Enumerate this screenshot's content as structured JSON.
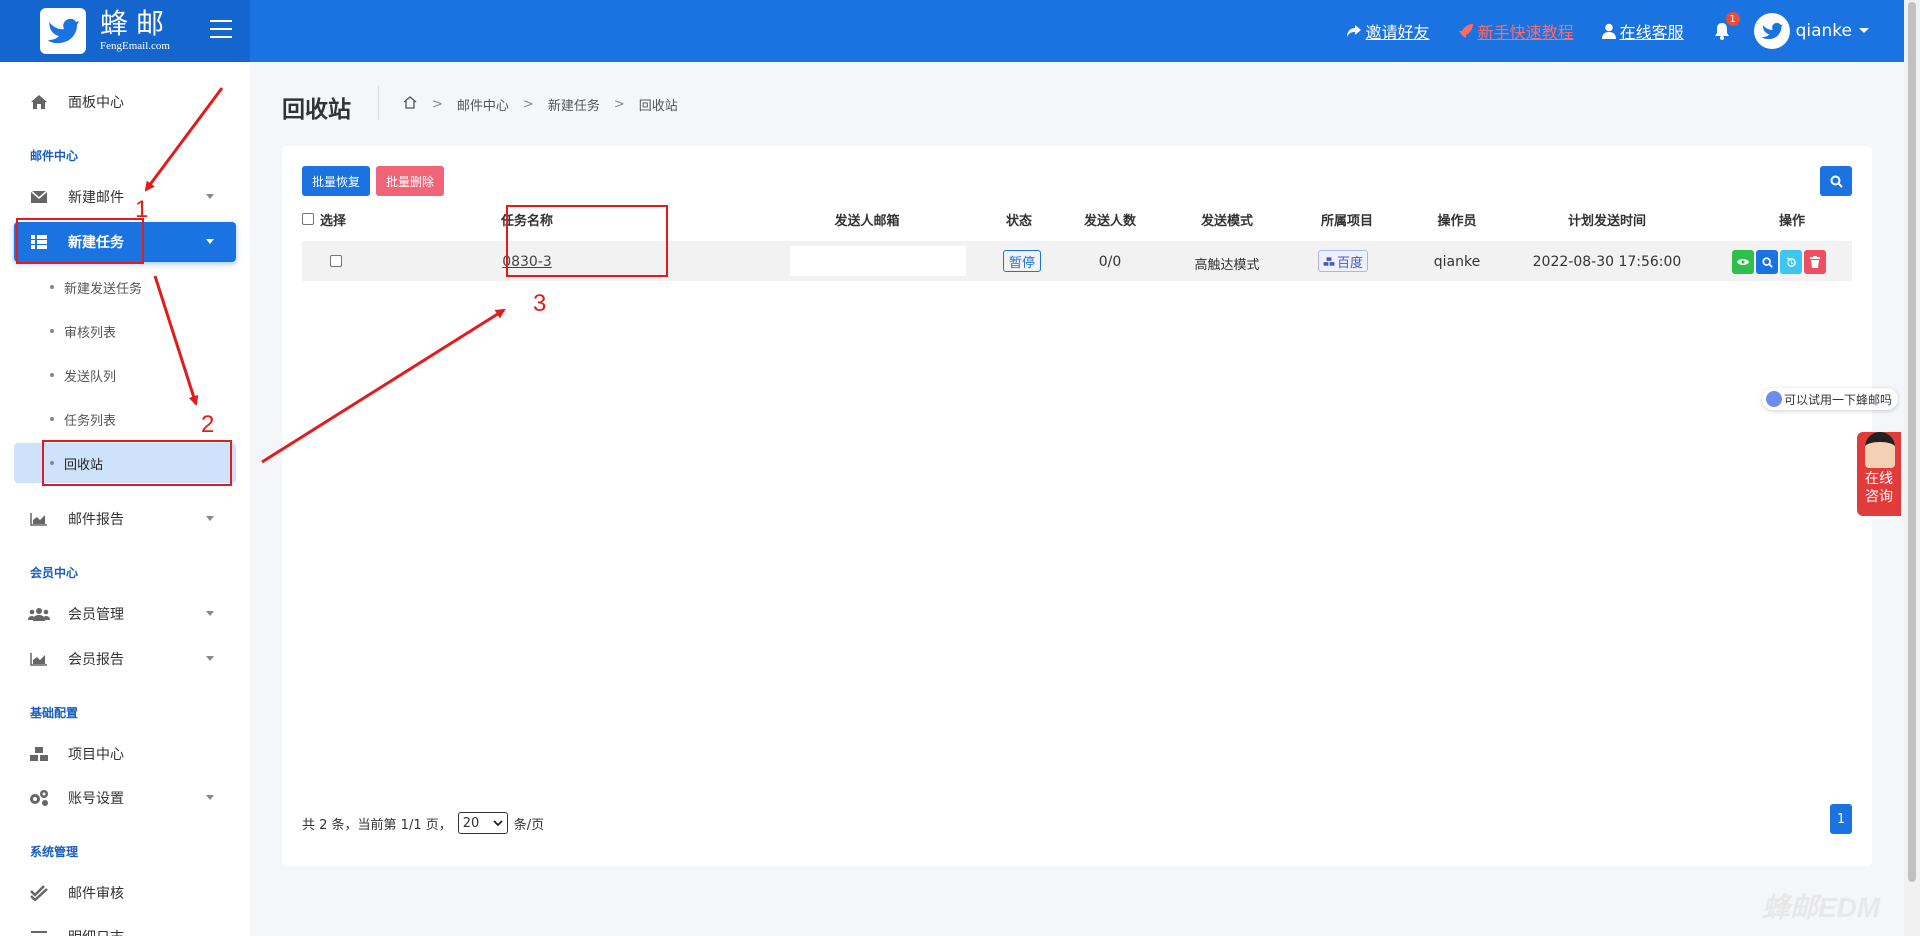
{
  "header": {
    "logo_cn": "蜂邮",
    "logo_en": "FengEmail.com",
    "invite": "邀请好友",
    "tutorial": "新手快速教程",
    "service": "在线客服",
    "bell_count": "1",
    "username": "qianke"
  },
  "sidebar": {
    "dashboard": "面板中心",
    "section_mail": "邮件中心",
    "new_mail": "新建邮件",
    "new_task": "新建任务",
    "sub_new_send": "新建发送任务",
    "sub_review": "审核列表",
    "sub_queue": "发送队列",
    "sub_task_list": "任务列表",
    "sub_recycle": "回收站",
    "mail_report": "邮件报告",
    "section_member": "会员中心",
    "member_manage": "会员管理",
    "member_report": "会员报告",
    "section_base": "基础配置",
    "project_center": "项目中心",
    "account_settings": "账号设置",
    "section_system": "系统管理",
    "mail_review": "邮件审核",
    "detail_log": "明细日志"
  },
  "page": {
    "title": "回收站",
    "breadcrumb": [
      "邮件中心",
      "新建任务",
      "回收站"
    ],
    "btn_restore": "批量恢复",
    "btn_delete": "批量删除"
  },
  "table": {
    "headers": {
      "select": "选择",
      "task_name": "任务名称",
      "sender": "发送人邮箱",
      "status": "状态",
      "count": "发送人数",
      "mode": "发送模式",
      "project": "所属项目",
      "operator": "操作员",
      "plan_time": "计划发送时间",
      "actions": "操作"
    },
    "rows": [
      {
        "task_name": "0830-3",
        "sender": "",
        "status": "暂停",
        "count": "0/0",
        "mode": "高触达模式",
        "project": "百度",
        "operator": "qianke",
        "plan_time": "2022-08-30 17:56:00"
      }
    ]
  },
  "footer": {
    "info_prefix": "共 2 条，当前第 1/1 页，",
    "page_size": "20",
    "info_suffix": "条/页",
    "current_page": "1"
  },
  "annotations": [
    "1",
    "2",
    "3"
  ],
  "widgets": {
    "chat_text": "可以试用一下蜂邮吗",
    "consult_line1": "在线",
    "consult_line2": "咨询",
    "watermark": "蜂邮EDM"
  },
  "colors": {
    "primary": "#1a73e0",
    "danger": "#f16478",
    "annotation": "#e21b1b",
    "view": "#2ec04a",
    "restore": "#3cc6f0",
    "trash": "#ee4e60"
  }
}
